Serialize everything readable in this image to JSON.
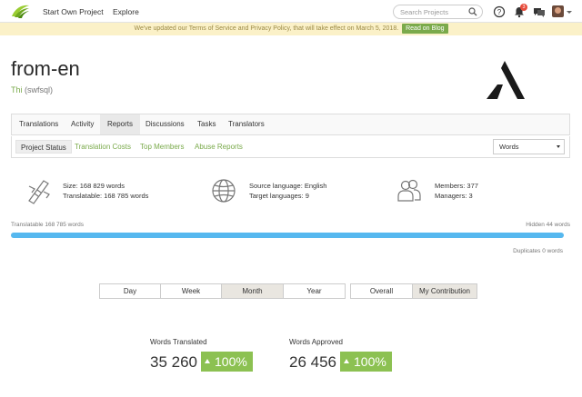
{
  "nav": {
    "start_own_project": "Start Own Project",
    "explore": "Explore",
    "search_placeholder": "Search Projects",
    "notifications_count": "3"
  },
  "notice": {
    "text": "We've updated our Terms of Service and Privacy Policy, that will take effect on March 5, 2018.",
    "button": "Read on Blog"
  },
  "project": {
    "title": "from-en",
    "owner_name": "Thi",
    "owner_login": "(swfsql)"
  },
  "tabs": [
    "Translations",
    "Activity",
    "Reports",
    "Discussions",
    "Tasks",
    "Translators"
  ],
  "subtabs": [
    "Project Status",
    "Translation Costs",
    "Top Members",
    "Abuse Reports"
  ],
  "unit_select": "Words",
  "stats": {
    "size": "Size: 168 829 words",
    "translatable": "Translatable: 168 785 words",
    "source_language": "Source language: English",
    "target_languages": "Target languages: 9",
    "members": "Members: 377",
    "managers": "Managers: 3"
  },
  "progress": {
    "left_label": "Translatable 168 785 words",
    "right_label": "Hidden 44 words",
    "duplicates": "Duplicates 0 words",
    "translatable_fraction": 0.9997
  },
  "periods": [
    "Day",
    "Week",
    "Month",
    "Year"
  ],
  "scopes": [
    "Overall",
    "My Contribution"
  ],
  "metrics": {
    "translated_label": "Words Translated",
    "translated_value": "35 260",
    "translated_pct": "100%",
    "approved_label": "Words Approved",
    "approved_value": "26 456",
    "approved_pct": "100%"
  },
  "colors": {
    "accent_green": "#7aaa4b",
    "progress_blue": "#56b8ef",
    "notice_bg": "#fbf1c8"
  }
}
